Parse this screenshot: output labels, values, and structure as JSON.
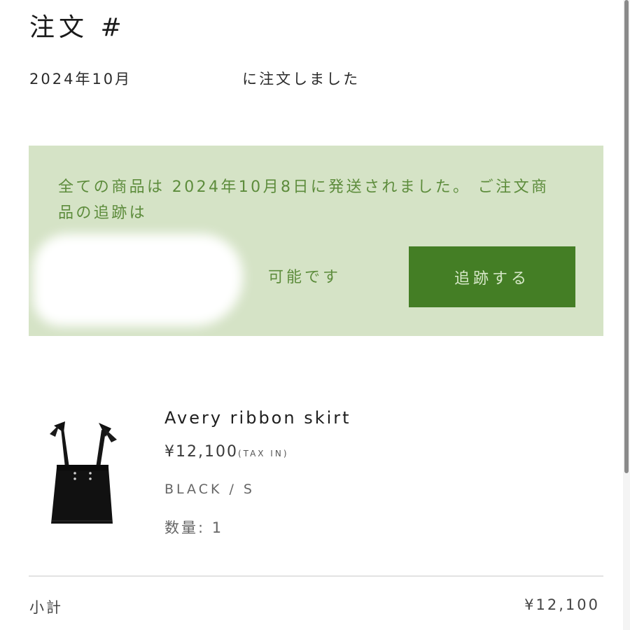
{
  "header": {
    "title": "注文",
    "hash": "#"
  },
  "order": {
    "date_prefix": "2024年10月",
    "date_suffix": "に注文しました"
  },
  "shipping": {
    "message": "全ての商品は 2024年10月8日に発送されました。 ご注文商品の追跡は",
    "available_text": "可能です",
    "track_button_label": "追跡する",
    "panel_color": "#d5e3c6",
    "text_color": "#5d8c3c",
    "button_color": "#447e25"
  },
  "item": {
    "name": "Avery ribbon skirt",
    "price": "¥12,100",
    "tax_note": "(TAX IN)",
    "variant": "BLACK / S",
    "quantity": "数量: 1",
    "image_icon": "black-skirt-with-ribbon-straps"
  },
  "summary": {
    "subtotal_label": "小計",
    "subtotal_value": "¥12,100"
  }
}
